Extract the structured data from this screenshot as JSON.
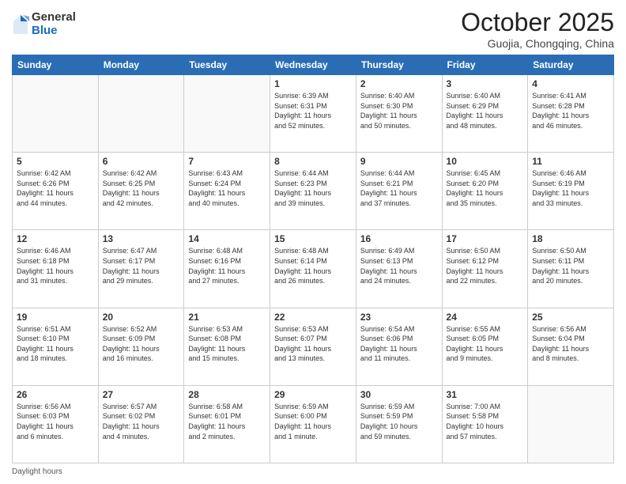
{
  "header": {
    "logo_general": "General",
    "logo_blue": "Blue",
    "title": "October 2025",
    "location": "Guojia, Chongqing, China"
  },
  "days_of_week": [
    "Sunday",
    "Monday",
    "Tuesday",
    "Wednesday",
    "Thursday",
    "Friday",
    "Saturday"
  ],
  "footer_text": "Daylight hours",
  "weeks": [
    [
      {
        "day": "",
        "info": ""
      },
      {
        "day": "",
        "info": ""
      },
      {
        "day": "",
        "info": ""
      },
      {
        "day": "1",
        "info": "Sunrise: 6:39 AM\nSunset: 6:31 PM\nDaylight: 11 hours\nand 52 minutes."
      },
      {
        "day": "2",
        "info": "Sunrise: 6:40 AM\nSunset: 6:30 PM\nDaylight: 11 hours\nand 50 minutes."
      },
      {
        "day": "3",
        "info": "Sunrise: 6:40 AM\nSunset: 6:29 PM\nDaylight: 11 hours\nand 48 minutes."
      },
      {
        "day": "4",
        "info": "Sunrise: 6:41 AM\nSunset: 6:28 PM\nDaylight: 11 hours\nand 46 minutes."
      }
    ],
    [
      {
        "day": "5",
        "info": "Sunrise: 6:42 AM\nSunset: 6:26 PM\nDaylight: 11 hours\nand 44 minutes."
      },
      {
        "day": "6",
        "info": "Sunrise: 6:42 AM\nSunset: 6:25 PM\nDaylight: 11 hours\nand 42 minutes."
      },
      {
        "day": "7",
        "info": "Sunrise: 6:43 AM\nSunset: 6:24 PM\nDaylight: 11 hours\nand 40 minutes."
      },
      {
        "day": "8",
        "info": "Sunrise: 6:44 AM\nSunset: 6:23 PM\nDaylight: 11 hours\nand 39 minutes."
      },
      {
        "day": "9",
        "info": "Sunrise: 6:44 AM\nSunset: 6:21 PM\nDaylight: 11 hours\nand 37 minutes."
      },
      {
        "day": "10",
        "info": "Sunrise: 6:45 AM\nSunset: 6:20 PM\nDaylight: 11 hours\nand 35 minutes."
      },
      {
        "day": "11",
        "info": "Sunrise: 6:46 AM\nSunset: 6:19 PM\nDaylight: 11 hours\nand 33 minutes."
      }
    ],
    [
      {
        "day": "12",
        "info": "Sunrise: 6:46 AM\nSunset: 6:18 PM\nDaylight: 11 hours\nand 31 minutes."
      },
      {
        "day": "13",
        "info": "Sunrise: 6:47 AM\nSunset: 6:17 PM\nDaylight: 11 hours\nand 29 minutes."
      },
      {
        "day": "14",
        "info": "Sunrise: 6:48 AM\nSunset: 6:16 PM\nDaylight: 11 hours\nand 27 minutes."
      },
      {
        "day": "15",
        "info": "Sunrise: 6:48 AM\nSunset: 6:14 PM\nDaylight: 11 hours\nand 26 minutes."
      },
      {
        "day": "16",
        "info": "Sunrise: 6:49 AM\nSunset: 6:13 PM\nDaylight: 11 hours\nand 24 minutes."
      },
      {
        "day": "17",
        "info": "Sunrise: 6:50 AM\nSunset: 6:12 PM\nDaylight: 11 hours\nand 22 minutes."
      },
      {
        "day": "18",
        "info": "Sunrise: 6:50 AM\nSunset: 6:11 PM\nDaylight: 11 hours\nand 20 minutes."
      }
    ],
    [
      {
        "day": "19",
        "info": "Sunrise: 6:51 AM\nSunset: 6:10 PM\nDaylight: 11 hours\nand 18 minutes."
      },
      {
        "day": "20",
        "info": "Sunrise: 6:52 AM\nSunset: 6:09 PM\nDaylight: 11 hours\nand 16 minutes."
      },
      {
        "day": "21",
        "info": "Sunrise: 6:53 AM\nSunset: 6:08 PM\nDaylight: 11 hours\nand 15 minutes."
      },
      {
        "day": "22",
        "info": "Sunrise: 6:53 AM\nSunset: 6:07 PM\nDaylight: 11 hours\nand 13 minutes."
      },
      {
        "day": "23",
        "info": "Sunrise: 6:54 AM\nSunset: 6:06 PM\nDaylight: 11 hours\nand 11 minutes."
      },
      {
        "day": "24",
        "info": "Sunrise: 6:55 AM\nSunset: 6:05 PM\nDaylight: 11 hours\nand 9 minutes."
      },
      {
        "day": "25",
        "info": "Sunrise: 6:56 AM\nSunset: 6:04 PM\nDaylight: 11 hours\nand 8 minutes."
      }
    ],
    [
      {
        "day": "26",
        "info": "Sunrise: 6:56 AM\nSunset: 6:03 PM\nDaylight: 11 hours\nand 6 minutes."
      },
      {
        "day": "27",
        "info": "Sunrise: 6:57 AM\nSunset: 6:02 PM\nDaylight: 11 hours\nand 4 minutes."
      },
      {
        "day": "28",
        "info": "Sunrise: 6:58 AM\nSunset: 6:01 PM\nDaylight: 11 hours\nand 2 minutes."
      },
      {
        "day": "29",
        "info": "Sunrise: 6:59 AM\nSunset: 6:00 PM\nDaylight: 11 hours\nand 1 minute."
      },
      {
        "day": "30",
        "info": "Sunrise: 6:59 AM\nSunset: 5:59 PM\nDaylight: 10 hours\nand 59 minutes."
      },
      {
        "day": "31",
        "info": "Sunrise: 7:00 AM\nSunset: 5:58 PM\nDaylight: 10 hours\nand 57 minutes."
      },
      {
        "day": "",
        "info": ""
      }
    ]
  ]
}
